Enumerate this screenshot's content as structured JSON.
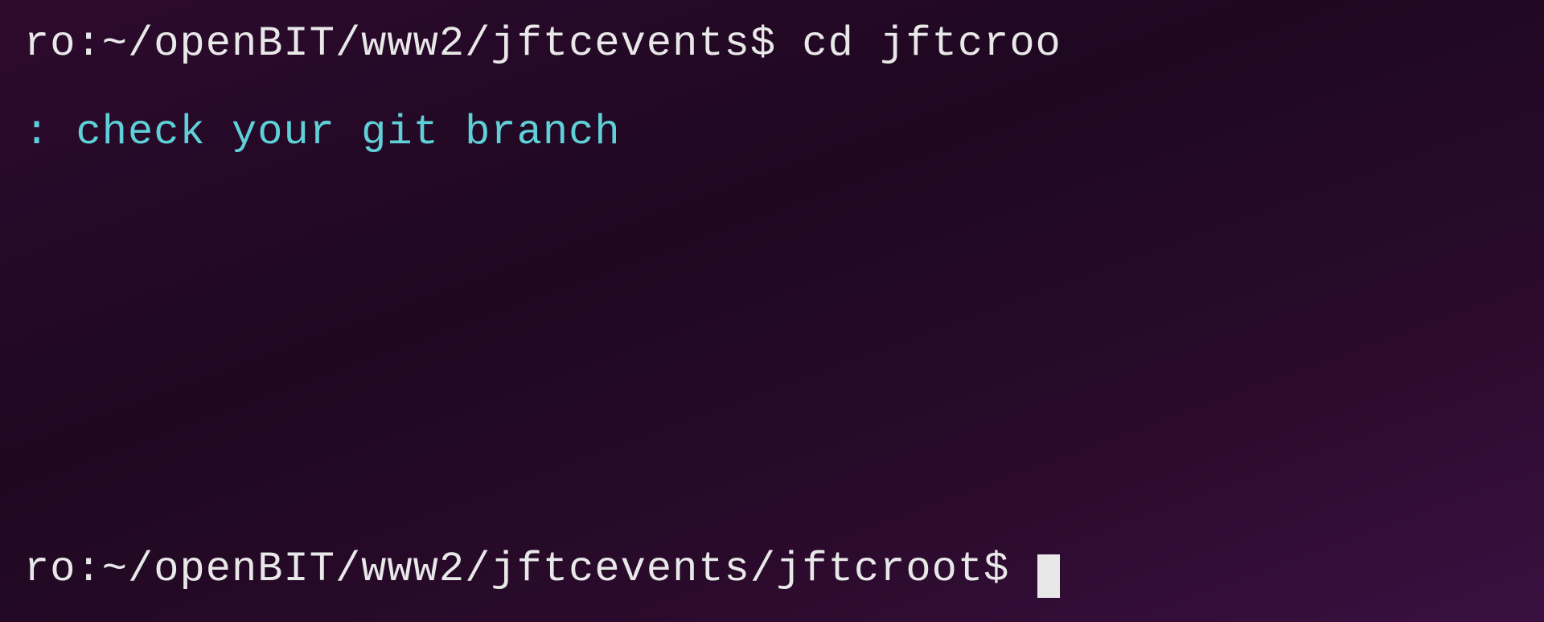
{
  "terminal": {
    "background_color": "#2d0a2e",
    "text_color": "#e8e8e8",
    "accent_color": "#5fd0d8",
    "lines": {
      "top": {
        "text": "ro:~/openBIT/www2/jftcevents$ cd jftcroo",
        "color": "#e8e8e8"
      },
      "middle": {
        "text": ": check your git branch",
        "color": "#5fd0d8"
      },
      "bottom": {
        "text": "ro:~/openBIT/www2/jftcevents/jftcroot$ ",
        "color": "#e8e8e8"
      }
    }
  }
}
